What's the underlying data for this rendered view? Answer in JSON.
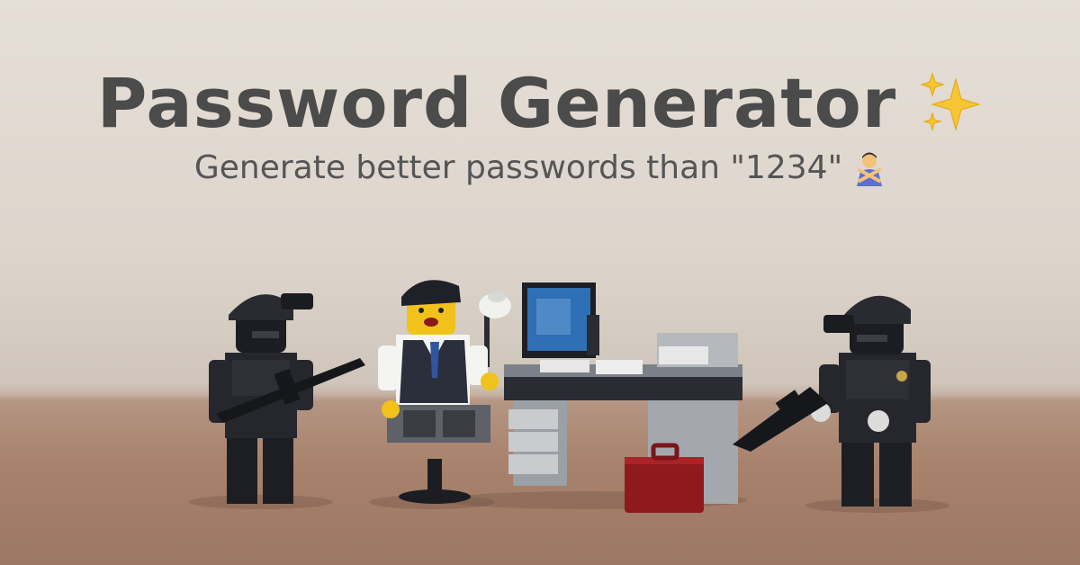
{
  "header": {
    "title": "Password Generator",
    "subtitle": "Generate better passwords than \"1234\""
  },
  "icons": {
    "title_icon": "sparkles-icon",
    "subtitle_icon": "person-gesturing-no-icon"
  },
  "colors": {
    "title": "#4b4b4b",
    "subtitle": "#555555",
    "background": "#e0d8cf",
    "table": "#a8826c"
  }
}
